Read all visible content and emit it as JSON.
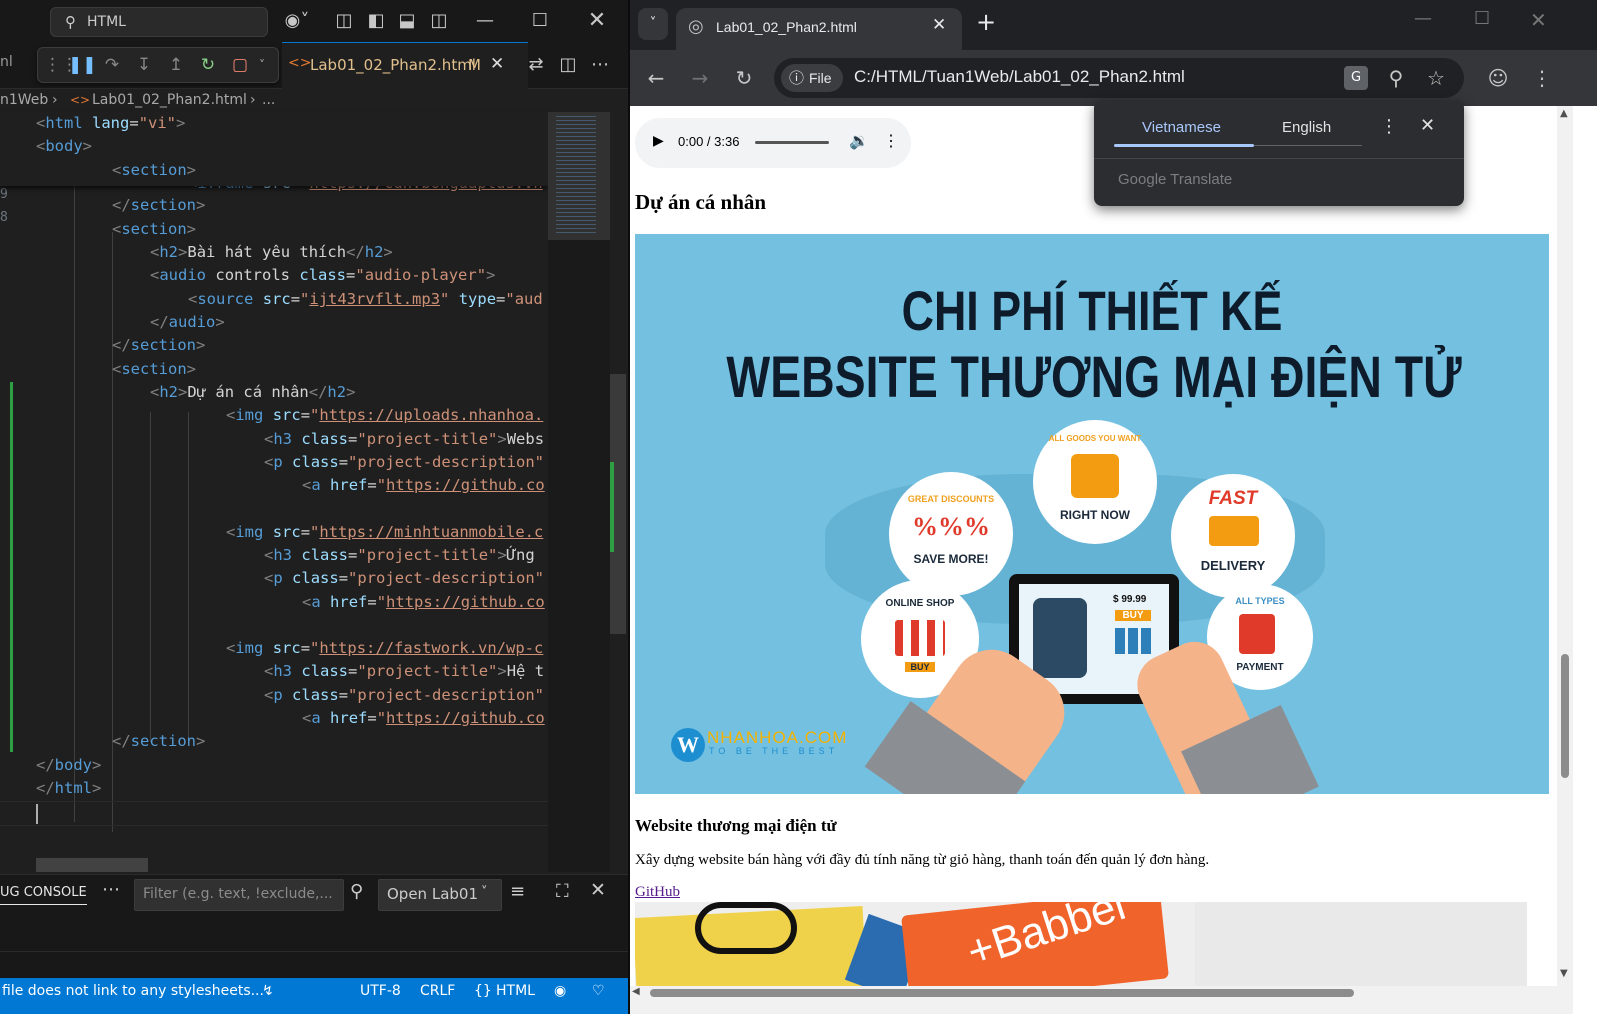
{
  "vscode": {
    "title_search": "HTML",
    "editor_tab": {
      "filename": "Lab01_02_Phan2.html",
      "status": "M"
    },
    "left_partial_label": "nl",
    "breadcrumb": {
      "folder": "n1Web",
      "file": "Lab01_02_Phan2.html",
      "more": "..."
    },
    "code_lines": [
      {
        "text": "<html lang=\"vi\">"
      },
      {
        "text": "<body>"
      },
      {
        "text": "<section>"
      },
      {
        "text": "<iframe src=\"https://cdn.bongdaplus.vn"
      },
      {
        "text": "</section>"
      },
      {
        "text": "<section>"
      },
      {
        "text": "<h2>Bài hát yêu thích</h2>"
      },
      {
        "text": "<audio controls class=\"audio-player\">"
      },
      {
        "text": "<source src=\"ijt43rvflt.mp3\" type=\"aud"
      },
      {
        "text": "</audio>"
      },
      {
        "text": "</section>"
      },
      {
        "text": "<section>"
      },
      {
        "text": "<h2>Dự án cá nhân</h2>"
      },
      {
        "text": "<img src=\"https://uploads.nhanhoa."
      },
      {
        "text": "<h3 class=\"project-title\">Webs"
      },
      {
        "text": "<p class=\"project-description\""
      },
      {
        "text": "<a href=\"https://github.co"
      },
      {
        "text": "<img src=\"https://minhtuanmobile.c"
      },
      {
        "text": "<h3 class=\"project-title\">Ứng"
      },
      {
        "text": "<p class=\"project-description\""
      },
      {
        "text": "<a href=\"https://github.co"
      },
      {
        "text": "<img src=\"https://fastwork.vn/wp-c"
      },
      {
        "text": "<h3 class=\"project-title\">Hệ t"
      },
      {
        "text": "<p class=\"project-description\""
      },
      {
        "text": "<a href=\"https://github.co"
      },
      {
        "text": "</section>"
      },
      {
        "text": "</body>"
      },
      {
        "text": "</html>"
      }
    ],
    "panel": {
      "tab_label": "UG CONSOLE",
      "filter_placeholder": "Filter (e.g. text, !exclude,...",
      "dropdown_value": "Open Lab01"
    },
    "statusbar": {
      "message": "file does not link to any stylesheets...",
      "encoding": "UTF-8",
      "eol": "CRLF",
      "language": "HTML"
    },
    "colors": {
      "accent": "#0078d4",
      "tag": "#569cd6",
      "attr": "#9cdcfe",
      "string": "#ce9178"
    }
  },
  "chrome": {
    "tab_title": "Lab01_02_Phan2.html",
    "file_chip": "File",
    "url": "C:/HTML/Tuan1Web/Lab01_02_Phan2.html",
    "translate_popup": {
      "lang_active": "Vietnamese",
      "lang_other": "English",
      "footer": "Google Translate"
    },
    "page": {
      "audio_time": "0:00 / 3:36",
      "heading": "Dự án cá nhân",
      "banner": {
        "line1": "CHI PHÍ THIẾT KẾ",
        "line2": "WEBSITE THƯƠNG MẠI ĐIỆN TỬ",
        "bubble_discounts_top": "GREAT DISCOUNTS",
        "bubble_discounts_bottom": "SAVE MORE!",
        "bubble_goods_top": "ALL GOODS YOU WANT",
        "bubble_goods_bottom": "RIGHT NOW",
        "bubble_fast": "FAST",
        "bubble_delivery": "DELIVERY",
        "bubble_shop": "ONLINE SHOP",
        "bubble_buy": "BUY",
        "bubble_types": "ALL TYPES",
        "bubble_payment": "PAYMENT",
        "price": "$ 99.99",
        "buy_button": "BUY",
        "brand": "NHANHOA.COM",
        "brand_letter": "W",
        "tagline": "TO BE THE BEST"
      },
      "project_title": "Website thương mại điện tử",
      "project_description": "Xây dựng website bán hàng với đầy đủ tính năng từ giỏ hàng, thanh toán đến quản lý đơn hàng.",
      "link": "GitHub",
      "img2_text": "+Babbel"
    }
  }
}
